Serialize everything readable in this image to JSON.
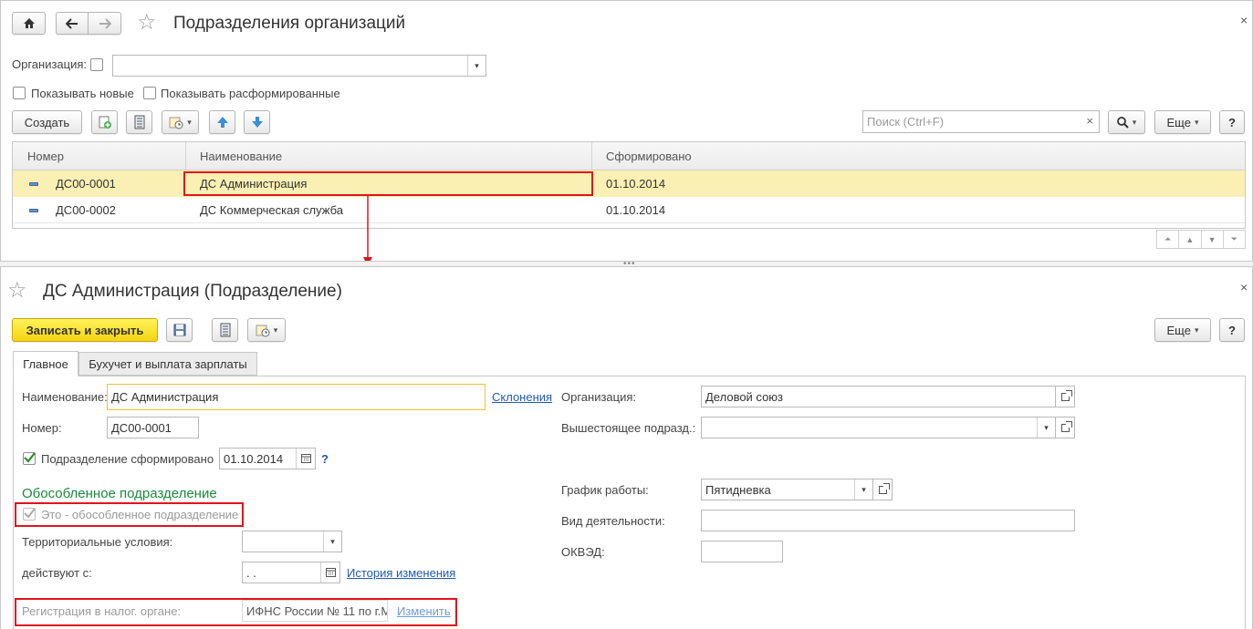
{
  "list_window": {
    "title": "Подразделения организаций",
    "filter": {
      "org_label": "Организация:",
      "org_value": "",
      "show_new_label": "Показывать новые",
      "show_disbanded_label": "Показывать расформированные"
    },
    "toolbar": {
      "create_label": "Создать",
      "search_placeholder": "Поиск (Ctrl+F)",
      "more_label": "Еще",
      "help_label": "?"
    },
    "table": {
      "columns": [
        "Номер",
        "Наименование",
        "Сформировано"
      ],
      "rows": [
        {
          "number": "ДС00-0001",
          "name": "ДС Администрация",
          "formed": "01.10.2014"
        },
        {
          "number": "ДС00-0002",
          "name": "ДС Коммерческая служба",
          "formed": "01.10.2014"
        }
      ]
    }
  },
  "form_window": {
    "title": "ДС Администрация (Подразделение)",
    "toolbar": {
      "save_close_label": "Записать и закрыть",
      "more_label": "Еще",
      "help_label": "?"
    },
    "tabs": [
      "Главное",
      "Бухучет и выплата зарплаты"
    ],
    "fields": {
      "name_label": "Наименование:",
      "name_value": "ДС Администрация",
      "declension_link": "Склонения",
      "number_label": "Номер:",
      "number_value": "ДС00-0001",
      "formed_label": "Подразделение сформировано",
      "formed_date": "01.10.2014",
      "formed_help": "?",
      "separate_section_title": "Обособленное подразделение",
      "is_separate_label": "Это - обособленное подразделение",
      "territorial_label": "Территориальные условия:",
      "territorial_value": "",
      "effective_from_label": "действуют с:",
      "effective_from_value": " .  .",
      "history_link": "История изменения",
      "tax_reg_label": "Регистрация в налог. органе:",
      "tax_reg_value": "ИФНС России № 11 по г.М",
      "change_link": "Изменить",
      "org_label": "Организация:",
      "org_value": "Деловой союз",
      "parent_label": "Вышестоящее подразд.:",
      "parent_value": "",
      "schedule_label": "График работы:",
      "schedule_value": "Пятидневка",
      "activity_label": "Вид деятельности:",
      "activity_value": "",
      "okved_label": "ОКВЭД:",
      "okved_value": ""
    }
  },
  "colors": {
    "selected_row": "#fbf0b4",
    "accent_yellow": "#f5d312",
    "highlight_red": "#e0141c",
    "section_green": "#1b8a3a",
    "link_blue": "#1d5bb8"
  }
}
